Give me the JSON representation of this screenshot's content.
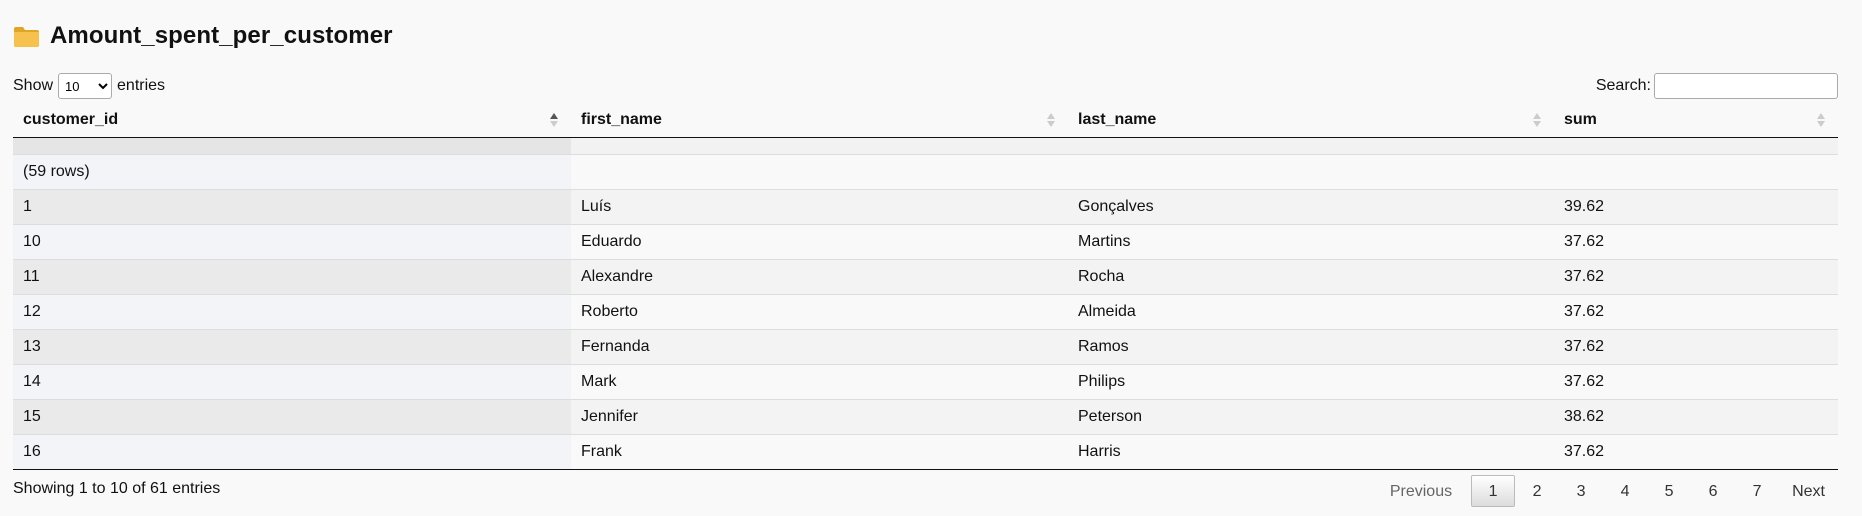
{
  "title": "Amount_spent_per_customer",
  "controls": {
    "show_label": "Show",
    "entries_label": "entries",
    "length_selected": "10",
    "search_label": "Search:",
    "search_value": ""
  },
  "columns": [
    "customer_id",
    "first_name",
    "last_name",
    "sum"
  ],
  "summary_row": "(59 rows)",
  "rows": [
    [
      "1",
      "Luís",
      "Gonçalves",
      "39.62"
    ],
    [
      "10",
      "Eduardo",
      "Martins",
      "37.62"
    ],
    [
      "11",
      "Alexandre",
      "Rocha",
      "37.62"
    ],
    [
      "12",
      "Roberto",
      "Almeida",
      "37.62"
    ],
    [
      "13",
      "Fernanda",
      "Ramos",
      "37.62"
    ],
    [
      "14",
      "Mark",
      "Philips",
      "37.62"
    ],
    [
      "15",
      "Jennifer",
      "Peterson",
      "38.62"
    ],
    [
      "16",
      "Frank",
      "Harris",
      "37.62"
    ]
  ],
  "footer": {
    "info": "Showing 1 to 10 of 61 entries",
    "previous": "Previous",
    "next": "Next",
    "pages": [
      "1",
      "2",
      "3",
      "4",
      "5",
      "6",
      "7"
    ],
    "current_page": "1"
  },
  "icons": {
    "title": "folder-icon",
    "sort_asc": "sort-asc-icon",
    "sort_both": "sort-both-icon"
  },
  "colors": {
    "folder": "#f7c14d",
    "folder_dark": "#e0a526"
  }
}
